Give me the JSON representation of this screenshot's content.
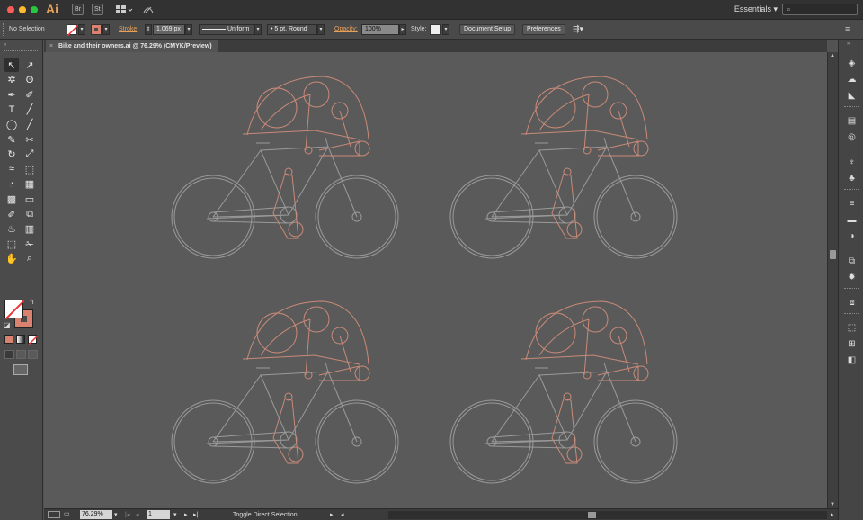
{
  "app": {
    "logo": "Ai",
    "bridge_buttons": [
      "Br",
      "St"
    ],
    "workspace": "Essentials",
    "search_placeholder": ""
  },
  "controlbar": {
    "selection": "No Selection",
    "stroke_label": "Stroke",
    "stroke_weight": "1.069 px",
    "profile": "Uniform",
    "brush": "5 pt. Round",
    "opacity_label": "Opacity:",
    "opacity_value": "100%",
    "style_label": "Style:",
    "doc_setup": "Document Setup",
    "preferences": "Preferences"
  },
  "document": {
    "tab_title": "Bike and their owners.ai @ 76.29% (CMYK/Preview)",
    "close": "×"
  },
  "statusbar": {
    "zoom": "76.29%",
    "artboard": "1",
    "status_text": "Toggle Direct Selection"
  },
  "colors": {
    "rider_stroke": "#c98a78",
    "bike_stroke": "#9a9a9a",
    "canvas": "#5a5a5a",
    "accent": "#e7a058"
  },
  "icons": {
    "tools": [
      "selection-icon",
      "direct-selection-icon",
      "magic-wand-icon",
      "lasso-icon",
      "pen-icon",
      "curvature-icon",
      "type-icon",
      "line-icon",
      "ellipse-icon",
      "paintbrush-icon",
      "pencil-icon",
      "scissors-icon",
      "rotate-icon",
      "scale-icon",
      "warp-icon",
      "free-transform-icon",
      "shape-builder-icon",
      "perspective-icon",
      "mesh-icon",
      "gradient-icon",
      "eyedropper-icon",
      "blend-icon",
      "symbol-sprayer-icon",
      "graph-icon",
      "artboard-icon",
      "slice-icon",
      "hand-icon",
      "zoom-icon"
    ]
  }
}
